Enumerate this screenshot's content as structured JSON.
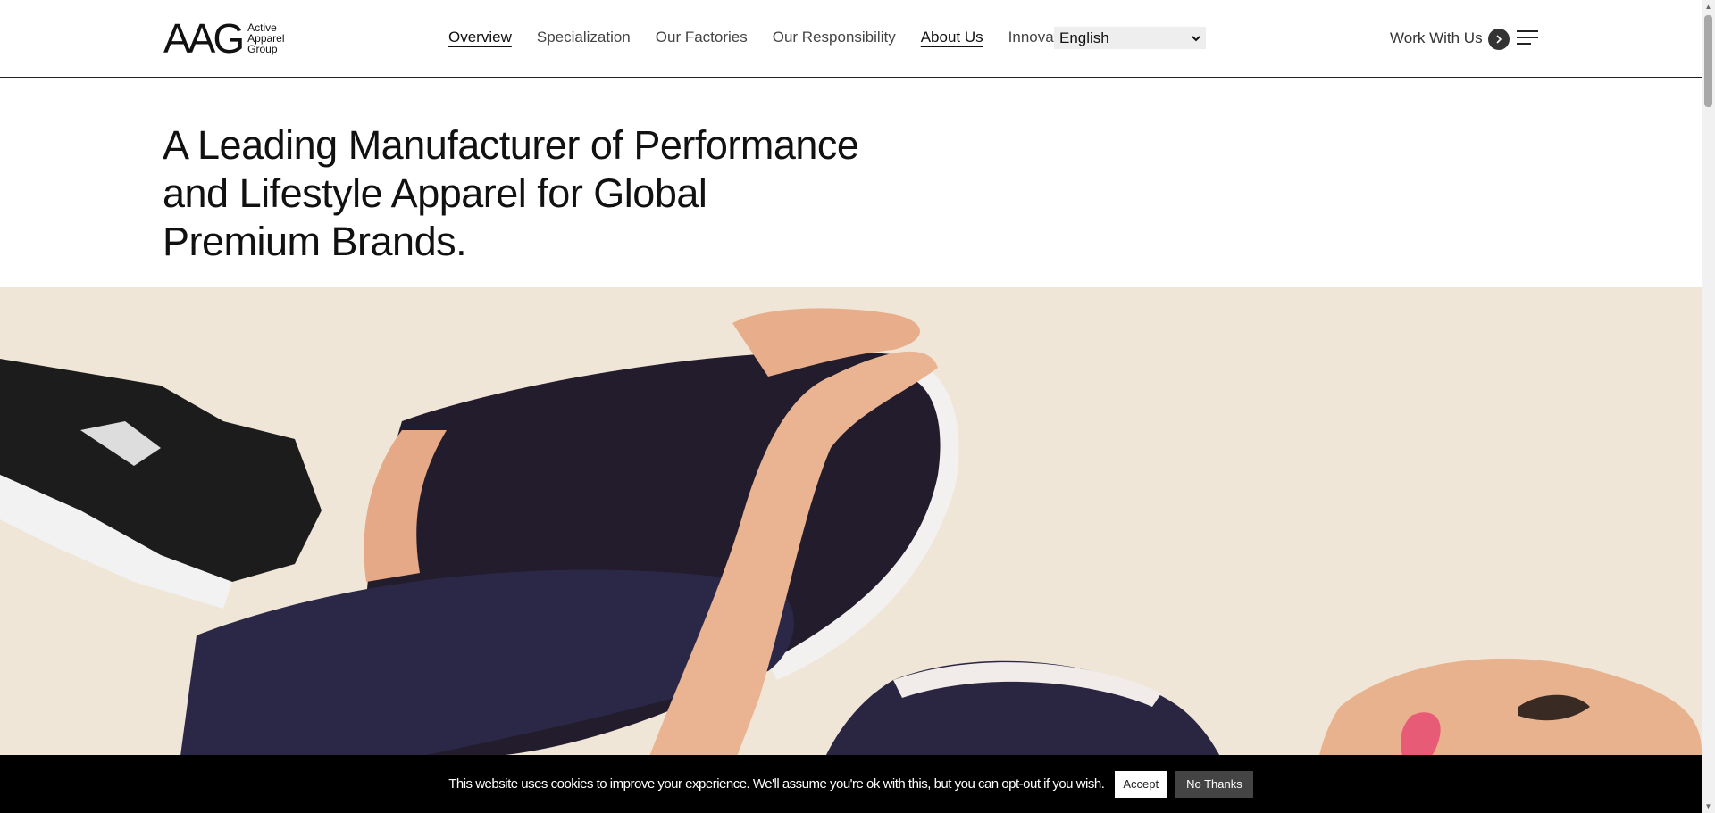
{
  "header": {
    "logo_mark": "AAG",
    "logo_words": [
      "Active",
      "Apparel",
      "Group"
    ],
    "nav": [
      {
        "label": "Overview",
        "active": true
      },
      {
        "label": "Specialization",
        "active": false
      },
      {
        "label": "Our Factories",
        "active": false
      },
      {
        "label": "Our Responsibility",
        "active": false
      },
      {
        "label": "About Us",
        "active": true
      },
      {
        "label": "Innovation",
        "active": false
      }
    ],
    "language": {
      "selected": "English"
    },
    "cta": "Work With Us"
  },
  "hero": {
    "title": "A Leading Manufacturer of Performance and Lifestyle Apparel for Global Premium Brands."
  },
  "cookie": {
    "message": "This website uses cookies to improve your experience. We'll assume you're ok with this, but you can opt-out if you wish.",
    "accept": "Accept",
    "decline": "No Thanks"
  },
  "icons": {
    "cta_arrow": "chevron-right-icon",
    "menu": "hamburger-menu-icon",
    "lang_chevron": "chevron-down-icon"
  },
  "colors": {
    "header_border": "#222222",
    "lang_bg": "#eeeeee",
    "cookie_bg": "#000000",
    "hero_bg": "#efe6d8",
    "leggings": "#221c2c"
  }
}
